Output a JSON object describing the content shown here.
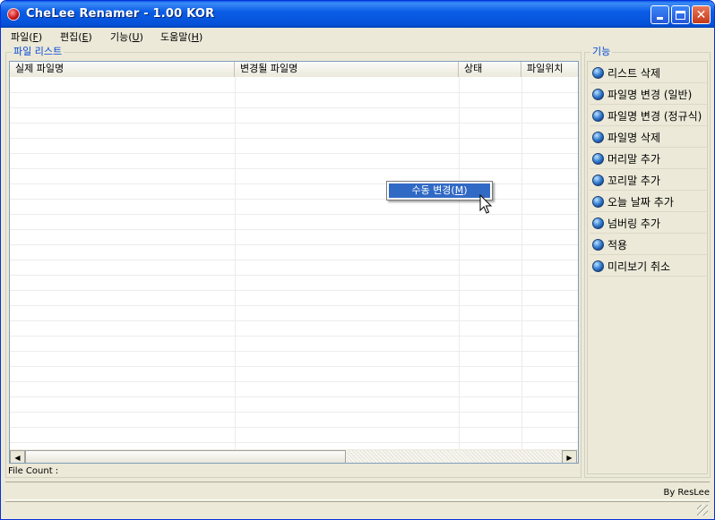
{
  "window": {
    "title": "CheLee Renamer - 1.00 KOR",
    "icon": "app-heart-icon",
    "controls": [
      "minimize-icon",
      "maximize-icon",
      "close-icon"
    ],
    "close_glyph": "✕"
  },
  "menu": [
    {
      "label": "파일(F)",
      "text": "파일(",
      "key": "F",
      "tail": ")"
    },
    {
      "label": "편집(E)",
      "text": "편집(",
      "key": "E",
      "tail": ")"
    },
    {
      "label": "기능(U)",
      "text": "기능(",
      "key": "U",
      "tail": ")"
    },
    {
      "label": "도움말(H)",
      "text": "도움말(",
      "key": "H",
      "tail": ")"
    }
  ],
  "file_list": {
    "group_label": "파일 리스트",
    "columns": [
      "실제 파일명",
      "변경될 파일명",
      "상태",
      "파일위치"
    ],
    "rows": [],
    "file_count_label": "File Count :"
  },
  "functions": {
    "group_label": "기능",
    "buttons": [
      "리스트 삭제",
      "파일명 변경 (일반)",
      "파일명 변경 (정규식)",
      "파일명 삭제",
      "머리말 추가",
      "꼬리말 추가",
      "오늘 날짜 추가",
      "넘버링 추가",
      "적용",
      "미리보기 취소"
    ],
    "icon": "globe-icon"
  },
  "context_menu": {
    "item_text": "수동 변경(",
    "item_key": "M",
    "item_tail": ")"
  },
  "status": {
    "credit": "By ResLee"
  },
  "colors": {
    "titlebar": "#0558d8",
    "menu_highlight": "#316ac5",
    "group_label": "#0046d5",
    "window_face": "#ece9d8"
  }
}
